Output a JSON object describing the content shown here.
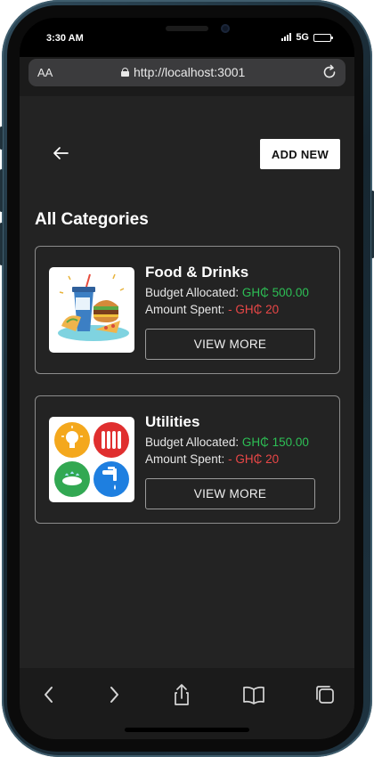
{
  "status_bar": {
    "time": "3:30 AM",
    "network": "5G"
  },
  "browser": {
    "text_size_label": "AA",
    "url": "http://localhost:3001",
    "icons": [
      "lock-icon",
      "reload-icon"
    ]
  },
  "page": {
    "add_new_label": "ADD NEW",
    "section_title": "All Categories",
    "background": "#232323",
    "categories": [
      {
        "name": "Food & Drinks",
        "budget_label": "Budget Allocated:",
        "budget_value": "GH₵ 500.00",
        "spent_label": "Amount Spent:",
        "spent_value": "- GH₵ 20",
        "button_label": "VIEW MORE",
        "image": "food-drinks-illustration"
      },
      {
        "name": "Utilities",
        "budget_label": "Budget Allocated:",
        "budget_value": "GH₵ 150.00",
        "spent_label": "Amount Spent:",
        "spent_value": "- GH₵ 20",
        "button_label": "VIEW MORE",
        "image": "utilities-illustration"
      }
    ]
  },
  "colors": {
    "budget_value": "#2dbf55",
    "spent_value": "#ea4747",
    "button_primary_bg": "#ffffff"
  },
  "toolbar": {
    "icons": [
      "back-icon",
      "forward-icon",
      "share-icon",
      "bookmarks-icon",
      "tabs-icon"
    ]
  }
}
